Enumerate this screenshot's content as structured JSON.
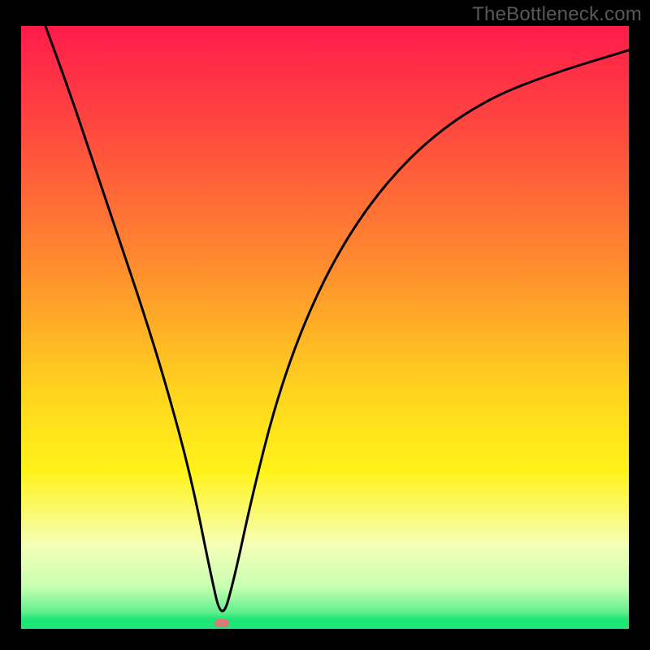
{
  "watermark": "TheBottleneck.com",
  "colors": {
    "gradient_stops": [
      {
        "pct": 0,
        "color": "#ff1b4b"
      },
      {
        "pct": 18,
        "color": "#ff4b3e"
      },
      {
        "pct": 40,
        "color": "#ff8d2e"
      },
      {
        "pct": 60,
        "color": "#ffd21e"
      },
      {
        "pct": 74,
        "color": "#fff31a"
      },
      {
        "pct": 86,
        "color": "#f6ffb6"
      },
      {
        "pct": 93,
        "color": "#c8ffb2"
      },
      {
        "pct": 100,
        "color": "#1ee576"
      }
    ],
    "curve_stroke": "#000000",
    "marker_fill": "#d77a78",
    "frame_bg": "#000000"
  },
  "chart_data": {
    "type": "line",
    "title": "",
    "xlabel": "",
    "ylabel": "",
    "x_range": [
      0,
      100
    ],
    "y_range": [
      0,
      100
    ],
    "min_point": {
      "x": 33,
      "y": 1
    },
    "series": [
      {
        "name": "bottleneck-curve",
        "points": [
          {
            "x": 4,
            "y": 100
          },
          {
            "x": 8,
            "y": 89
          },
          {
            "x": 12,
            "y": 77
          },
          {
            "x": 16,
            "y": 65
          },
          {
            "x": 20,
            "y": 53
          },
          {
            "x": 24,
            "y": 40
          },
          {
            "x": 28,
            "y": 25
          },
          {
            "x": 31,
            "y": 10
          },
          {
            "x": 33,
            "y": 1
          },
          {
            "x": 35,
            "y": 8
          },
          {
            "x": 38,
            "y": 22
          },
          {
            "x": 42,
            "y": 38
          },
          {
            "x": 47,
            "y": 52
          },
          {
            "x": 53,
            "y": 64
          },
          {
            "x": 60,
            "y": 74
          },
          {
            "x": 68,
            "y": 82
          },
          {
            "x": 77,
            "y": 88
          },
          {
            "x": 87,
            "y": 92
          },
          {
            "x": 100,
            "y": 96
          }
        ]
      }
    ]
  }
}
